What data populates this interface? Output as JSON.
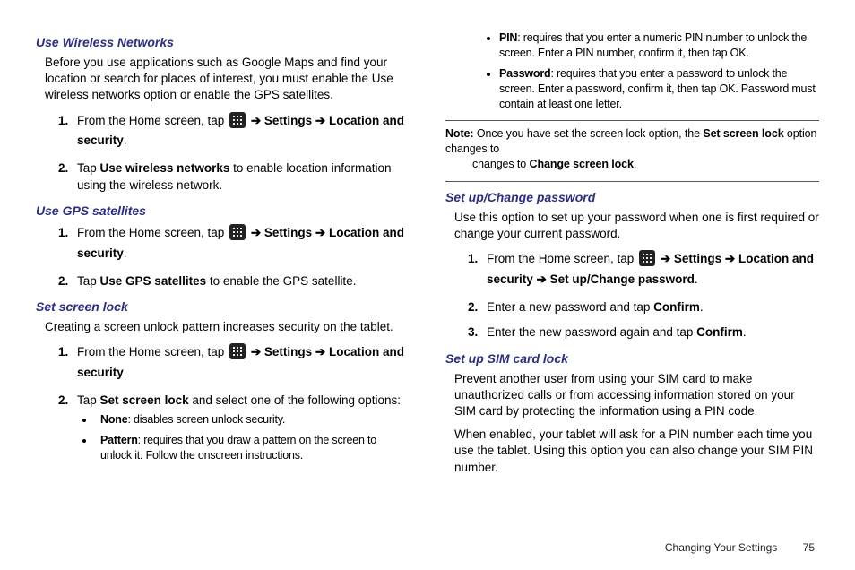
{
  "left": {
    "s1": {
      "head": "Use Wireless Networks",
      "p1": "Before you use applications such as Google Maps and find your location or search for places of interest, you must enable the Use wireless networks option or enable the GPS satellites.",
      "step1_a": "From the Home screen, tap ",
      "step1_b": " ➔ ",
      "step1_c": "Settings",
      "step1_d": " ➔ ",
      "step1_e": "Location and security",
      "step1_f": ".",
      "step2_a": "Tap ",
      "step2_b": "Use wireless networks",
      "step2_c": " to enable location information using the wireless network."
    },
    "s2": {
      "head": "Use GPS satellites",
      "step1_a": "From the Home screen, tap ",
      "step1_b": " ➔ ",
      "step1_c": "Settings",
      "step1_d": " ➔ ",
      "step1_e": "Location and security",
      "step1_f": ".",
      "step2_a": "Tap ",
      "step2_b": "Use GPS satellites",
      "step2_c": " to enable the GPS satellite."
    },
    "s3": {
      "head": "Set screen lock",
      "p1": "Creating a screen unlock pattern increases security on the tablet.",
      "step1_a": "From the Home screen, tap ",
      "step1_b": " ➔ ",
      "step1_c": "Settings",
      "step1_d": " ➔ ",
      "step1_e": "Location and security",
      "step1_f": ".",
      "step2_a": "Tap ",
      "step2_b": "Set screen lock",
      "step2_c": " and select one of the following options:",
      "b1_a": "None",
      "b1_b": ": disables screen unlock security.",
      "b2_a": "Pattern",
      "b2_b": ": requires that you draw a pattern on the screen to unlock it. Follow the onscreen instructions."
    }
  },
  "right": {
    "b3_a": "PIN",
    "b3_b": ": requires that you enter a numeric PIN number to unlock the screen. Enter a PIN number, confirm it, then tap OK.",
    "b4_a": "Password",
    "b4_b": ": requires that you enter a password to unlock the screen. Enter a password, confirm it, then tap OK. Password must contain at least one letter.",
    "note_a": "Note:",
    "note_b": " Once you have set the screen lock option, the ",
    "note_c": "Set screen lock",
    "note_d": " option changes to ",
    "note_e": "Change screen lock",
    "note_f": ".",
    "s4": {
      "head": "Set up/Change password",
      "p1": "Use this option to set up your password when one is first required or change your current password.",
      "step1_a": "From the Home screen, tap ",
      "step1_b": " ➔ ",
      "step1_c": "Settings",
      "step1_d": " ➔ ",
      "step1_e": "Location and security",
      "step1_f": " ➔ ",
      "step1_g": "Set up/Change password",
      "step1_h": ".",
      "step2_a": "Enter a new password and tap ",
      "step2_b": "Confirm",
      "step2_c": ".",
      "step3_a": "Enter the new password again and tap ",
      "step3_b": "Confirm",
      "step3_c": "."
    },
    "s5": {
      "head": "Set up SIM card lock",
      "p1": "Prevent another user from using your SIM card to make unauthorized calls or from accessing information stored on your SIM card by protecting the information using a PIN code.",
      "p2": "When enabled, your tablet will ask for a PIN number each time you use the tablet. Using this option you can also change your SIM PIN number."
    }
  },
  "footer": {
    "chapter": "Changing Your Settings",
    "page": "75"
  }
}
